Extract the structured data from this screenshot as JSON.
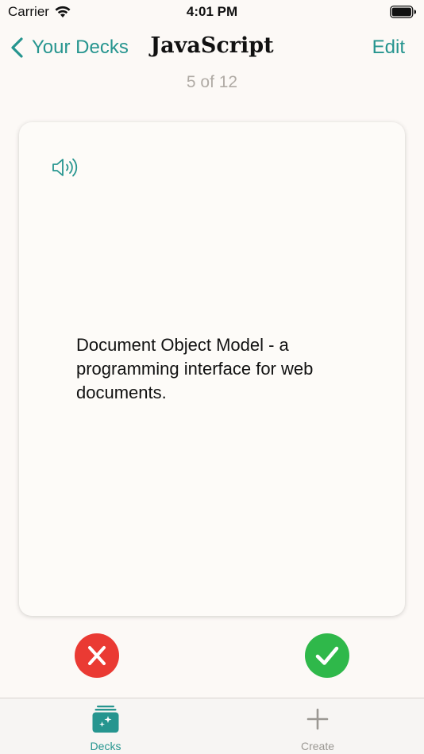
{
  "status_bar": {
    "carrier": "Carrier",
    "time": "4:01 PM",
    "icons": [
      "wifi-icon",
      "battery-icon"
    ]
  },
  "nav": {
    "back_label": "Your Decks",
    "title": "JavaScript",
    "edit_label": "Edit",
    "progress": "5 of 12"
  },
  "card": {
    "text": "Document Object Model - a programming interface for web documents.",
    "speaker_icon": "speaker-icon"
  },
  "actions": {
    "wrong_icon": "x-icon",
    "right_icon": "checkmark-icon"
  },
  "tabs": [
    {
      "label": "Decks",
      "icon": "decks-icon",
      "selected": true
    },
    {
      "label": "Create",
      "icon": "plus-icon",
      "selected": false
    }
  ],
  "colors": {
    "accent": "#26958f",
    "wrong": "#ea3a33",
    "right": "#2fb84a",
    "background": "#fcf9f6"
  }
}
